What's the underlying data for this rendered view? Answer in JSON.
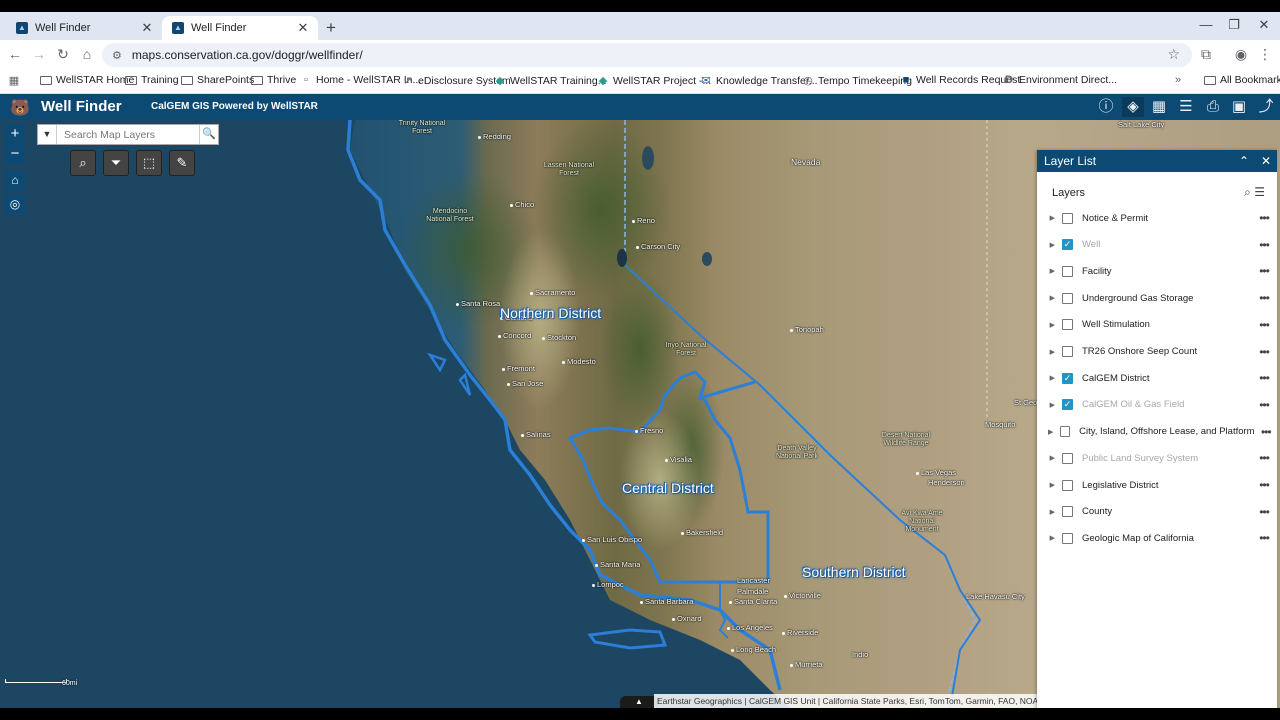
{
  "browser": {
    "tabs": [
      {
        "title": "Well Finder",
        "active": false
      },
      {
        "title": "Well Finder",
        "active": true
      }
    ],
    "new_tab": "+",
    "url": "maps.conservation.ca.gov/doggr/wellfinder/",
    "bookmarks": [
      {
        "label": "WellSTAR Home",
        "icon": "folder-icon"
      },
      {
        "label": "Training",
        "icon": "folder-icon"
      },
      {
        "label": "SharePoints",
        "icon": "folder-icon"
      },
      {
        "label": "Thrive",
        "icon": "folder-icon"
      },
      {
        "label": "Home - WellSTAR In...",
        "icon": "page-icon"
      },
      {
        "label": "eDisclosure System",
        "icon": "link-icon"
      },
      {
        "label": "WellSTAR Training...",
        "icon": "wellstar-icon"
      },
      {
        "label": "WellSTAR Project -...",
        "icon": "wellstar-icon"
      },
      {
        "label": "Knowledge Transfer...",
        "icon": "mail-icon"
      },
      {
        "label": "Tempo Timekeeping",
        "icon": "clock-icon"
      },
      {
        "label": "Well Records Request",
        "icon": "wellfinder-icon"
      },
      {
        "label": "Environment Direct...",
        "icon": "d-icon"
      }
    ],
    "all_bookmarks": "All Bookmarks"
  },
  "app": {
    "title": "Well Finder",
    "subtitle": "CalGEM GIS Powered by WellSTAR",
    "header_icons": [
      "info-icon",
      "layers-icon",
      "basemap-gallery-icon",
      "legend-icon",
      "print-icon",
      "bookmark-icon",
      "share-icon"
    ],
    "search_placeholder": "Search Map Layers",
    "widget_icons": [
      "query-icon",
      "filter-icon",
      "select-icon",
      "measure-icon"
    ]
  },
  "map": {
    "districts": [
      "Northern District",
      "Central District",
      "Southern District"
    ],
    "places": [
      "Trinity National Forest",
      "Redding",
      "Lassen National Forest",
      "Mendocino National Forest",
      "Chico",
      "Nevada",
      "Reno",
      "Carson City",
      "Sacramento",
      "Santa Rosa",
      "Oakland",
      "Concord",
      "Stockton",
      "Fremont",
      "San Jose",
      "Modesto",
      "Inyo National Forest",
      "Tonopah",
      "Salinas",
      "Fresno",
      "Visalia",
      "Death Valley National Park",
      "Desert National Wildlife Range",
      "Las Vegas",
      "Henderson",
      "Bakersfield",
      "Avi Kwa Ame National Monument",
      "San Luis Obispo",
      "Santa Maria",
      "Lompoc",
      "Lancaster",
      "Palmdale",
      "Santa Barbara",
      "Santa Clarita",
      "Victorville",
      "Oxnard",
      "Los Angeles",
      "Riverside",
      "Long Beach",
      "Murrieta",
      "Indio",
      "Lake Havasu City",
      "Mosquito",
      "St George",
      "Salt Lake City"
    ],
    "scale": "60mi",
    "attribution": "Earthstar Geographics | CalGEM GIS Unit | California State Parks, Esri, TomTom, Garmin, FAO, NOAA"
  },
  "layer_list": {
    "title": "Layer List",
    "section": "Layers",
    "layers": [
      {
        "label": "Notice & Permit",
        "checked": false,
        "dim": false
      },
      {
        "label": "Well",
        "checked": true,
        "dim": true
      },
      {
        "label": "Facility",
        "checked": false,
        "dim": false
      },
      {
        "label": "Underground Gas Storage",
        "checked": false,
        "dim": false
      },
      {
        "label": "Well Stimulation",
        "checked": false,
        "dim": false
      },
      {
        "label": "TR26 Onshore Seep Count",
        "checked": false,
        "dim": false
      },
      {
        "label": "CalGEM District",
        "checked": true,
        "dim": false
      },
      {
        "label": "CalGEM Oil & Gas Field",
        "checked": true,
        "dim": true
      },
      {
        "label": "City, Island, Offshore Lease, and Platform",
        "checked": false,
        "dim": false
      },
      {
        "label": "Public Land Survey System",
        "checked": false,
        "dim": true
      },
      {
        "label": "Legislative District",
        "checked": false,
        "dim": false
      },
      {
        "label": "County",
        "checked": false,
        "dim": false
      },
      {
        "label": "Geologic Map of California",
        "checked": false,
        "dim": false
      }
    ]
  }
}
